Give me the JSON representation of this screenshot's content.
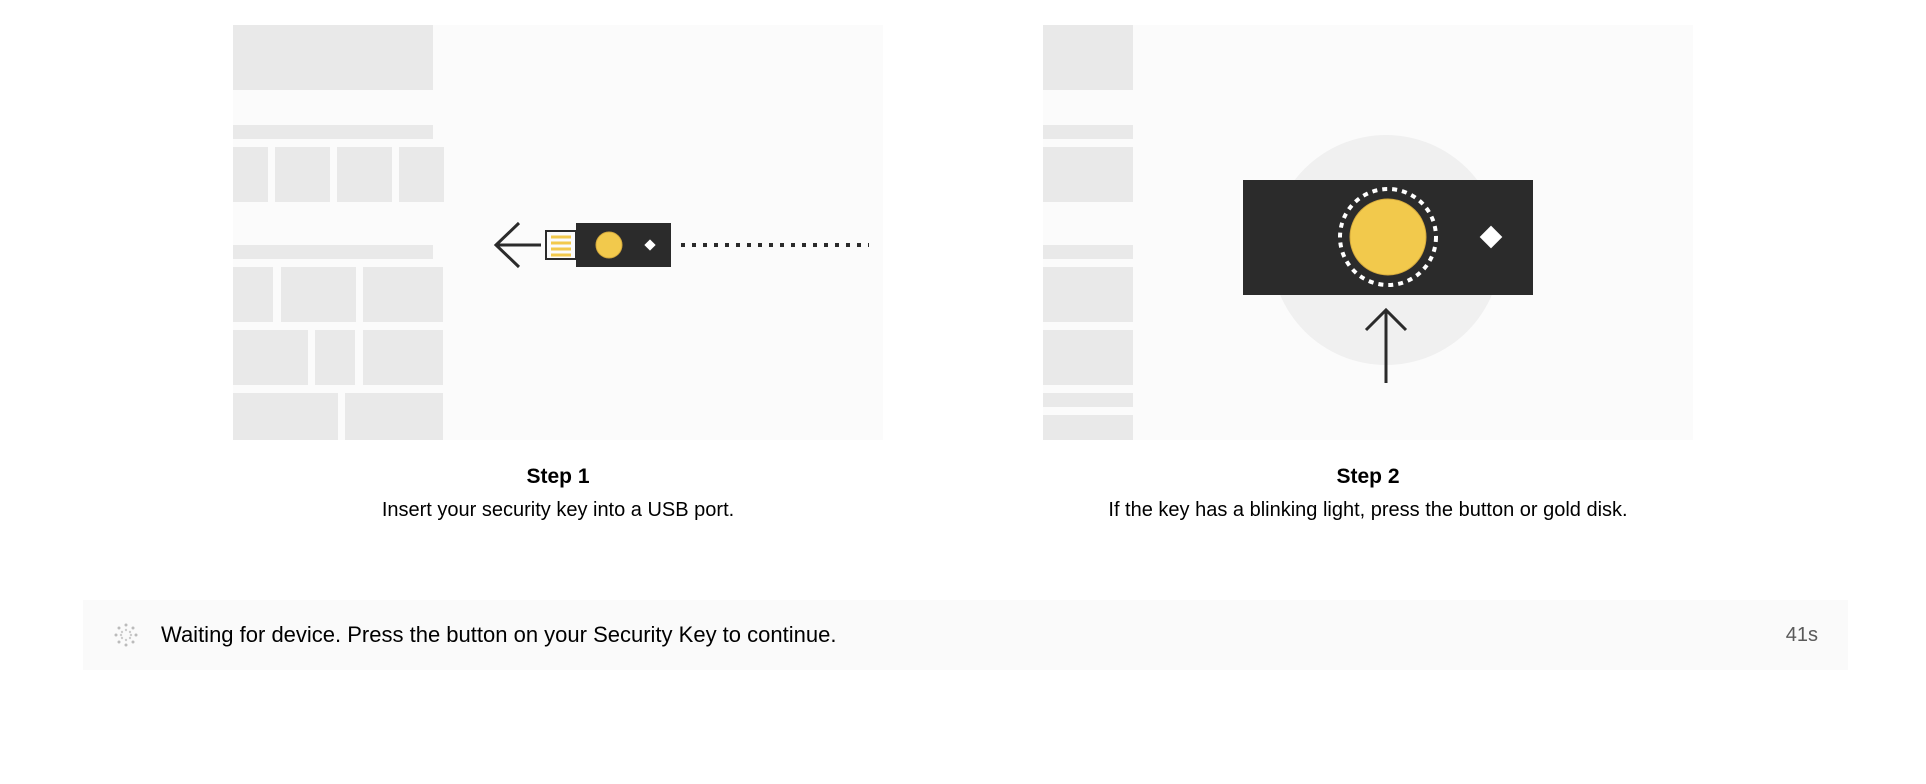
{
  "steps": [
    {
      "title": "Step 1",
      "description": "Insert your security key into a USB port."
    },
    {
      "title": "Step 2",
      "description": "If the key has a blinking light, press the button or gold disk."
    }
  ],
  "status": {
    "message": "Waiting for device. Press the button on your Security Key to continue.",
    "countdown": "41s"
  },
  "colors": {
    "gold": "#f2c94c",
    "dark": "#2b2b2b",
    "lightgray": "#e9e9e9",
    "bg": "#fbfbfb"
  }
}
